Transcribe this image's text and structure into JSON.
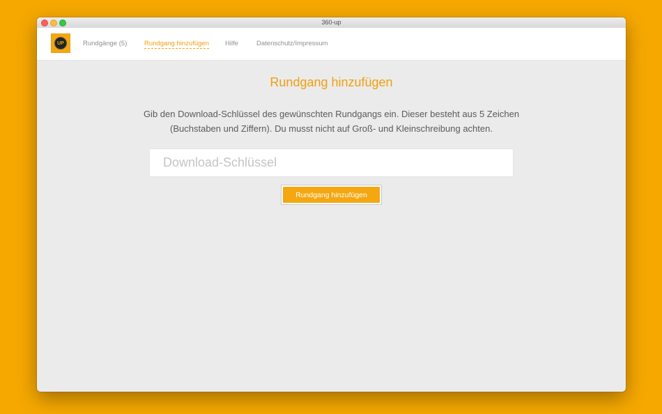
{
  "window": {
    "title": "360-up"
  },
  "logo": {
    "text": "UP",
    "icon": "360-up-logo-icon"
  },
  "nav": {
    "items": [
      {
        "label": "Rundgänge (5)",
        "active": false
      },
      {
        "label": "Rundgang hinzufügen",
        "active": true
      },
      {
        "label": "Hilfe",
        "active": false
      },
      {
        "label": "Datenschutz/Impressum",
        "active": false
      }
    ]
  },
  "main": {
    "heading": "Rundgang hinzufügen",
    "description": "Gib den Download-Schlüssel des gewünschten Rundgangs ein. Dieser besteht aus 5 Zeichen (Buchstaben und Ziffern). Du musst nicht auf Groß- und Kleinschreibung achten.",
    "input": {
      "value": "",
      "placeholder": "Download-Schlüssel"
    },
    "submit_label": "Rundgang hinzufügen"
  },
  "colors": {
    "background": "#F6A800",
    "accent": "#F0A010",
    "content_bg": "#EBEBEB"
  }
}
